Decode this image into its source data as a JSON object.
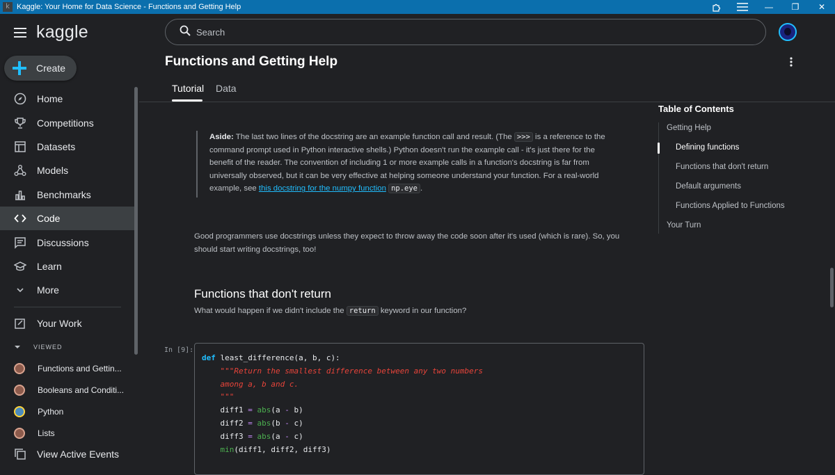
{
  "window": {
    "title": "Kaggle: Your Home for Data Science - Functions and Getting Help",
    "app_icon_letter": "k",
    "min_glyph": "—",
    "restore_glyph": "❐",
    "close_glyph": "✕"
  },
  "sidebar": {
    "logo": "kaggle",
    "create_label": "Create",
    "items": [
      {
        "label": "Home",
        "icon": "compass-icon"
      },
      {
        "label": "Competitions",
        "icon": "trophy-icon"
      },
      {
        "label": "Datasets",
        "icon": "table-icon"
      },
      {
        "label": "Models",
        "icon": "models-icon"
      },
      {
        "label": "Benchmarks",
        "icon": "bar-chart-icon"
      },
      {
        "label": "Code",
        "icon": "code-icon"
      },
      {
        "label": "Discussions",
        "icon": "chat-icon"
      },
      {
        "label": "Learn",
        "icon": "graduation-cap-icon"
      },
      {
        "label": "More",
        "icon": "chevron-down-icon"
      }
    ],
    "active_item": "Code",
    "your_work": "Your Work",
    "viewed_header": "VIEWED",
    "viewed": [
      {
        "label": "Functions and Gettin..."
      },
      {
        "label": "Booleans and Conditi..."
      },
      {
        "label": "Python"
      },
      {
        "label": "Lists"
      }
    ],
    "view_active_events": "View Active Events"
  },
  "header": {
    "search_placeholder": "Search",
    "page_title": "Functions and Getting Help",
    "tabs": [
      {
        "label": "Tutorial",
        "active": true
      },
      {
        "label": "Data",
        "active": false
      }
    ]
  },
  "article": {
    "aside": {
      "bold": "Aside:",
      "text1": " The last two lines of the docstring are an example function call and result. (The ",
      "code1": ">>>",
      "text2": " is a reference to the command prompt used in Python interactive shells.) Python doesn't run the example call - it's just there for the benefit of the reader. The convention of including 1 or more example calls in a function's docstring is far from universally observed, but it can be very effective at helping someone understand your function. For a real-world example, see ",
      "link": "this docstring for the numpy function",
      "code2": "np.eye",
      "text3": "."
    },
    "paragraph": "Good programmers use docstrings unless they expect to throw away the code soon after it's used (which is rare). So, you should start writing docstrings, too!",
    "section_title": "Functions that don't return",
    "section_desc_1": "What would happen if we didn't include the ",
    "section_desc_code": "return",
    "section_desc_2": " keyword in our function?",
    "cell_label": "In [9]:",
    "code": {
      "def_kw": "def",
      "signature": " least_difference(a, b, c):",
      "doc1": "\"\"\"Return the smallest difference between any two numbers",
      "doc2": "among a, b and c.",
      "doc3": "\"\"\"",
      "v1": "diff1",
      "v2": "diff2",
      "v3": "diff3",
      "eq": "=",
      "abs": "abs",
      "arg1": "(a ",
      "arg2": "(b ",
      "arg3": "(a ",
      "minus": "-",
      "end1": " b)",
      "end2": " c)",
      "end3": " c)",
      "min": "min",
      "min_args": "(diff1, diff2, diff3)"
    }
  },
  "toc": {
    "title": "Table of Contents",
    "items": [
      {
        "label": "Getting Help",
        "level": 1
      },
      {
        "label": "Defining functions",
        "level": 2,
        "active": true
      },
      {
        "label": "Functions that don't return",
        "level": 2
      },
      {
        "label": "Default arguments",
        "level": 2
      },
      {
        "label": "Functions Applied to Functions",
        "level": 2
      },
      {
        "label": "Your Turn",
        "level": 1
      }
    ]
  },
  "colors": {
    "accent": "#20beff",
    "titlebar": "#0b6fad",
    "background": "#202124"
  }
}
